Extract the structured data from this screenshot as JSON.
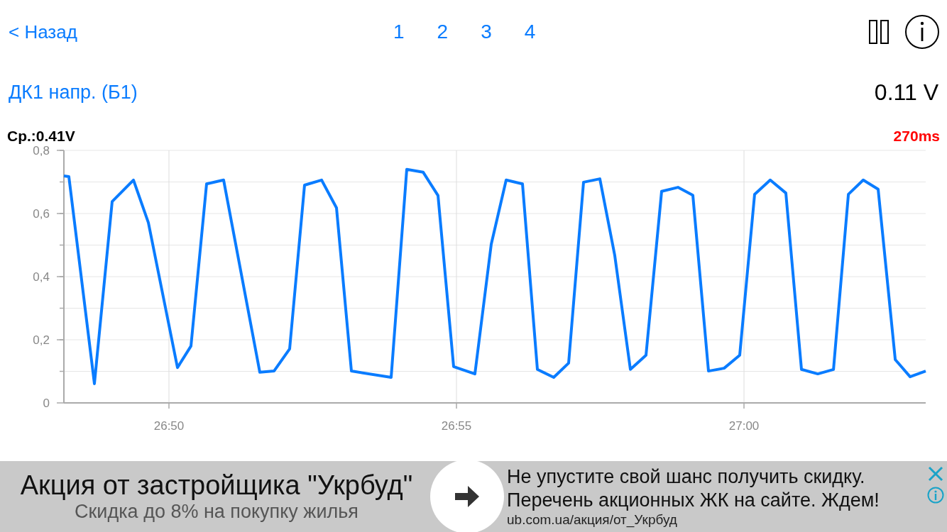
{
  "nav": {
    "back": "< Назад",
    "pages": [
      "1",
      "2",
      "3",
      "4"
    ]
  },
  "sensor": {
    "name": "ДК1 напр. (Б1)",
    "value": "0.11 V",
    "average": "Ср.:0.41V",
    "interval": "270ms",
    "chart_data": {
      "type": "line",
      "xlim": [
        1608.173,
        1623.16
      ],
      "ylim": [
        0,
        0.8
      ],
      "grid": true,
      "xticks": [
        {
          "value": 1610,
          "label": "26:50"
        },
        {
          "value": 1615,
          "label": "26:55"
        },
        {
          "value": 1620,
          "label": "27:00"
        }
      ],
      "yticks": [
        {
          "value": 0,
          "label": "0"
        },
        {
          "value": 0.2,
          "label": "0,2"
        },
        {
          "value": 0.4,
          "label": "0,4"
        },
        {
          "value": 0.6,
          "label": "0,6"
        },
        {
          "value": 0.8,
          "label": "0,8"
        }
      ],
      "x": [
        1608.173,
        1608.259,
        1608.704,
        1609.012,
        1609.383,
        1609.642,
        1610.148,
        1610.383,
        1610.654,
        1610.951,
        1611.58,
        1611.827,
        1612.099,
        1612.358,
        1612.654,
        1612.914,
        1613.173,
        1613.864,
        1614.136,
        1614.42,
        1614.679,
        1614.951,
        1615.321,
        1615.605,
        1615.864,
        1616.148,
        1616.407,
        1616.691,
        1616.951,
        1617.21,
        1617.494,
        1617.753,
        1618.025,
        1618.296,
        1618.568,
        1618.852,
        1619.111,
        1619.383,
        1619.654,
        1619.926,
        1620.185,
        1620.457,
        1620.728,
        1621.0,
        1621.284,
        1621.556,
        1621.815,
        1622.074,
        1622.333,
        1622.63,
        1622.889,
        1623.16
      ],
      "series": [
        {
          "color": "#0a7cff",
          "values": [
            0.719,
            0.717,
            0.061,
            0.638,
            0.706,
            0.571,
            0.112,
            0.18,
            0.694,
            0.706,
            0.097,
            0.101,
            0.171,
            0.69,
            0.706,
            0.618,
            0.101,
            0.081,
            0.74,
            0.731,
            0.657,
            0.115,
            0.092,
            0.503,
            0.706,
            0.694,
            0.106,
            0.081,
            0.126,
            0.699,
            0.71,
            0.467,
            0.106,
            0.151,
            0.67,
            0.683,
            0.658,
            0.101,
            0.11,
            0.151,
            0.661,
            0.706,
            0.665,
            0.106,
            0.092,
            0.106,
            0.661,
            0.706,
            0.677,
            0.137,
            0.083,
            0.101
          ]
        }
      ]
    }
  },
  "ad": {
    "headline": "Акция от застройщика \"Укрбуд\"",
    "subline": "Скидка до 8% на покупку жилья",
    "text": "Не упустите свой шанс получить скидку. Перечень акционных ЖК на сайте. Ждем!",
    "url": "ub.com.ua/акция/от_Укрбуд"
  }
}
